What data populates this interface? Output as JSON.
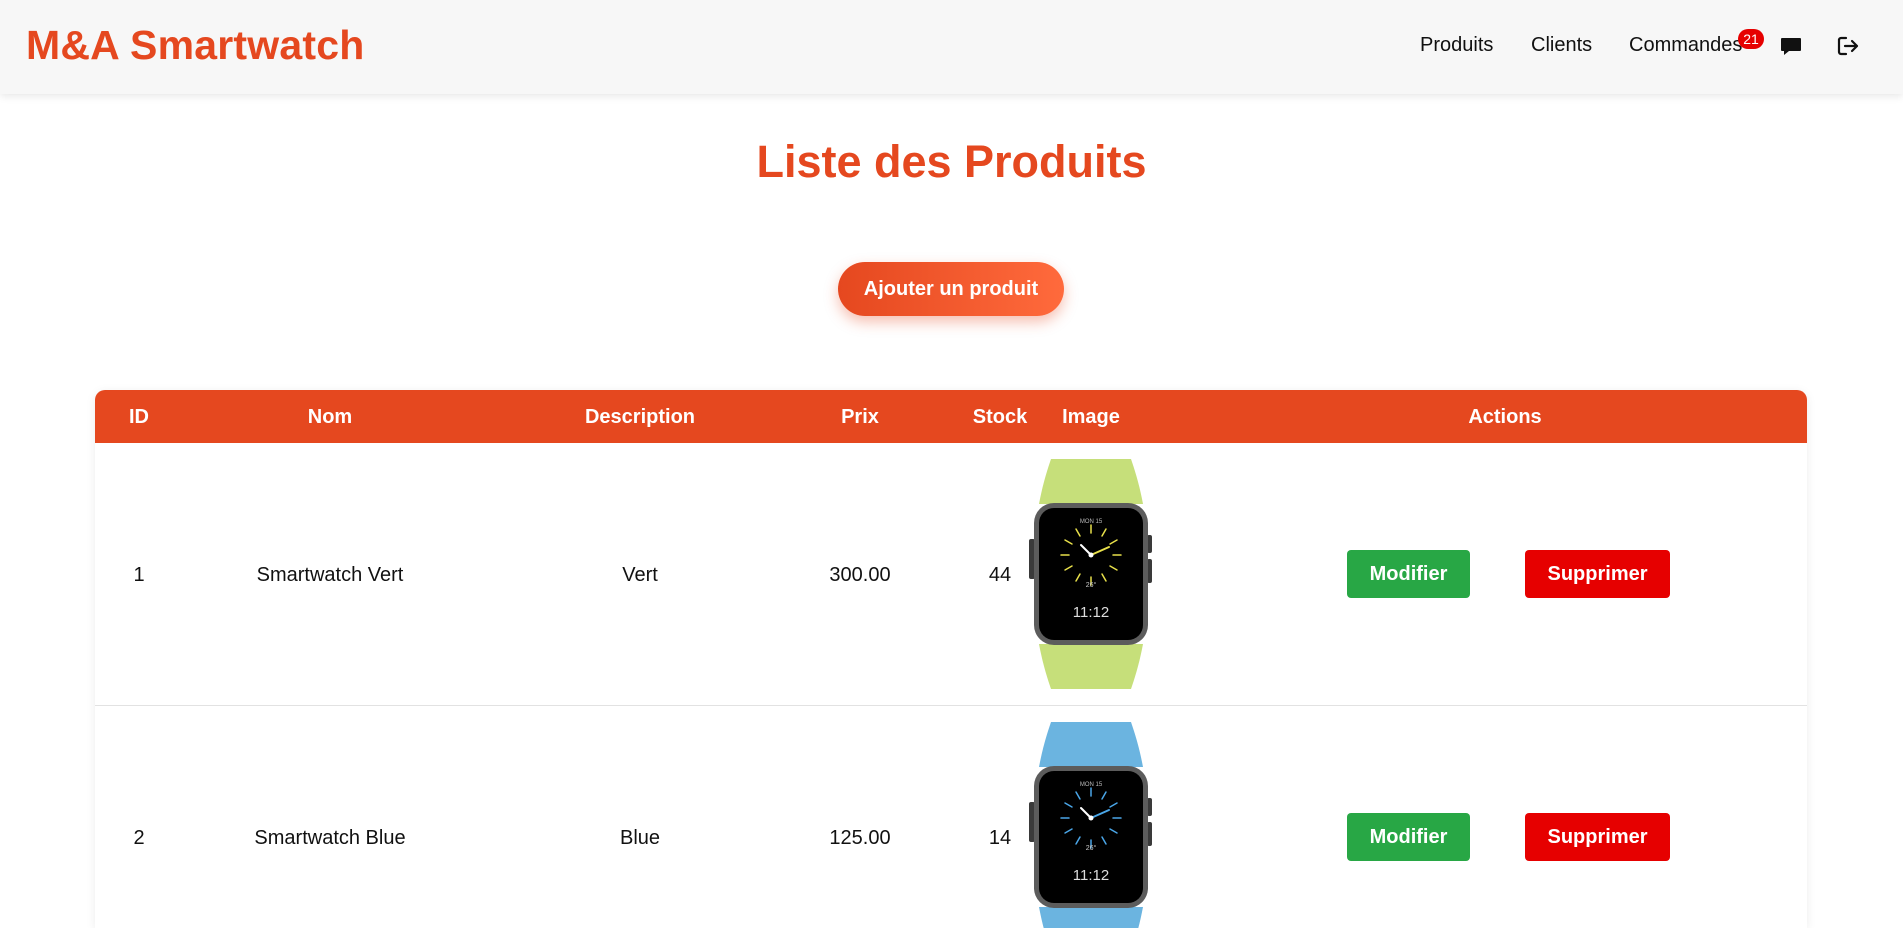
{
  "navbar": {
    "brand": "M&A Smartwatch",
    "links": [
      "Produits",
      "Clients",
      "Commandes"
    ],
    "orders_badge": "21",
    "icons": [
      "message-icon",
      "logout-icon"
    ]
  },
  "page": {
    "title": "Liste des Produits",
    "add_button": "Ajouter un produit"
  },
  "table": {
    "headers": [
      "ID",
      "Nom",
      "Description",
      "Prix",
      "Stock",
      "Image",
      "Actions"
    ],
    "edit_label": "Modifier",
    "delete_label": "Supprimer",
    "rows": [
      {
        "id": "1",
        "name": "Smartwatch Vert",
        "description": "Vert",
        "price": "300.00",
        "stock": "44",
        "band_color": "#c6df7a",
        "accent_color": "#e8e04a",
        "watch_time": "11:12",
        "watch_date": "MON 15",
        "watch_temp": "26°"
      },
      {
        "id": "2",
        "name": "Smartwatch Blue",
        "description": "Blue",
        "price": "125.00",
        "stock": "14",
        "band_color": "#6bb4e0",
        "accent_color": "#4aa6e8",
        "watch_time": "11:12",
        "watch_date": "MON 15",
        "watch_temp": "26°"
      }
    ]
  },
  "colors": {
    "accent": "#e5481f",
    "edit": "#28a745",
    "delete": "#e60000",
    "badge": "#e60000"
  }
}
